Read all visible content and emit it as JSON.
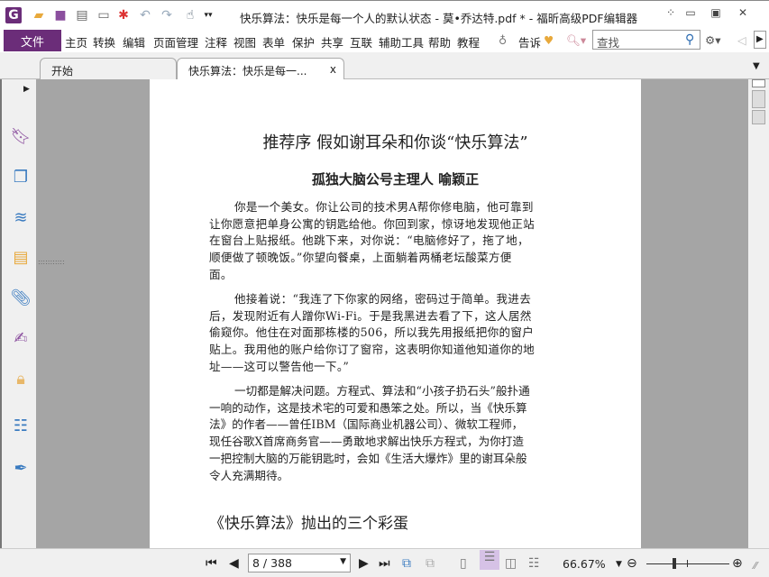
{
  "window": {
    "title": "快乐算法：快乐是每一个人的默认状态 - 莫•乔达特.pdf * - 福昕高级PDF编辑器",
    "app_icon": "foxit-logo",
    "controls": [
      "restore-grid-icon",
      "minimize-icon",
      "maximize-icon",
      "close-icon"
    ]
  },
  "quick_access": [
    "open-folder-icon",
    "save-icon",
    "print-icon",
    "properties-icon",
    "new-icon",
    "undo-icon",
    "redo-icon",
    "hand-tool-icon"
  ],
  "menu": {
    "file": "文件",
    "items": [
      "主页",
      "转换",
      "编辑",
      "页面管理",
      "注释",
      "视图",
      "表单",
      "保护",
      "共享",
      "互联",
      "辅助工具",
      "帮助",
      "教程"
    ],
    "tell_me": "告诉",
    "search_placeholder": "查找"
  },
  "tabs": [
    {
      "label": "开始",
      "active": false
    },
    {
      "label": "快乐算法：快乐是每一...",
      "active": true,
      "close": "x"
    }
  ],
  "sidebar": [
    "bookmark-icon",
    "pages-icon",
    "layers-icon",
    "comments-icon",
    "attachment-icon",
    "signature-icon",
    "security-icon",
    "form-icon",
    "certify-icon"
  ],
  "document": {
    "title": "推荐序 假如谢耳朵和你谈“快乐算法”",
    "subtitle": "孤独大脑公号主理人 喻颖正",
    "para1": [
      "你是一个美女。你让公司的技术男A帮你修电脑，他可靠到",
      "让你愿意把单身公寓的钥匙给他。你回到家，惊讶地发现他正站",
      "在窗台上贴报纸。他跳下来，对你说：“电脑修好了，拖了地，",
      "顺便做了顿晚饭。”你望向餐桌，上面躺着两桶老坛酸菜方便",
      "面。"
    ],
    "para2": [
      "他接着说：“我连了下你家的网络，密码过于简单。我进去",
      "后，发现附近有人蹭你Wi-Fi。于是我黑进去看了下，这人居然",
      "偷窥你。他住在对面那栋楼的506，所以我先用报纸把你的窗户",
      "贴上。我用他的账户给你订了窗帘，这表明你知道他知道你的地",
      "址——这可以警告他一下。”"
    ],
    "para3": [
      "一切都是解决问题。方程式、算法和“小孩子扔石头”般扑通",
      "一响的动作，这是技术宅的可爱和愚笨之处。所以，当《快乐算",
      "法》的作者——曾任IBM（国际商业机器公司）、微软工程师，",
      "现任谷歌X首席商务官——勇敢地求解出快乐方程式，为你打造",
      "一把控制大脑的万能钥匙时，会如《生活大爆炸》里的谢耳朵般",
      "令人充满期待。"
    ],
    "heading2": "《快乐算法》抛出的三个彩蛋"
  },
  "statusbar": {
    "page": "8 / 388",
    "zoom": "66.67%",
    "zoom_slider": 0.33
  }
}
